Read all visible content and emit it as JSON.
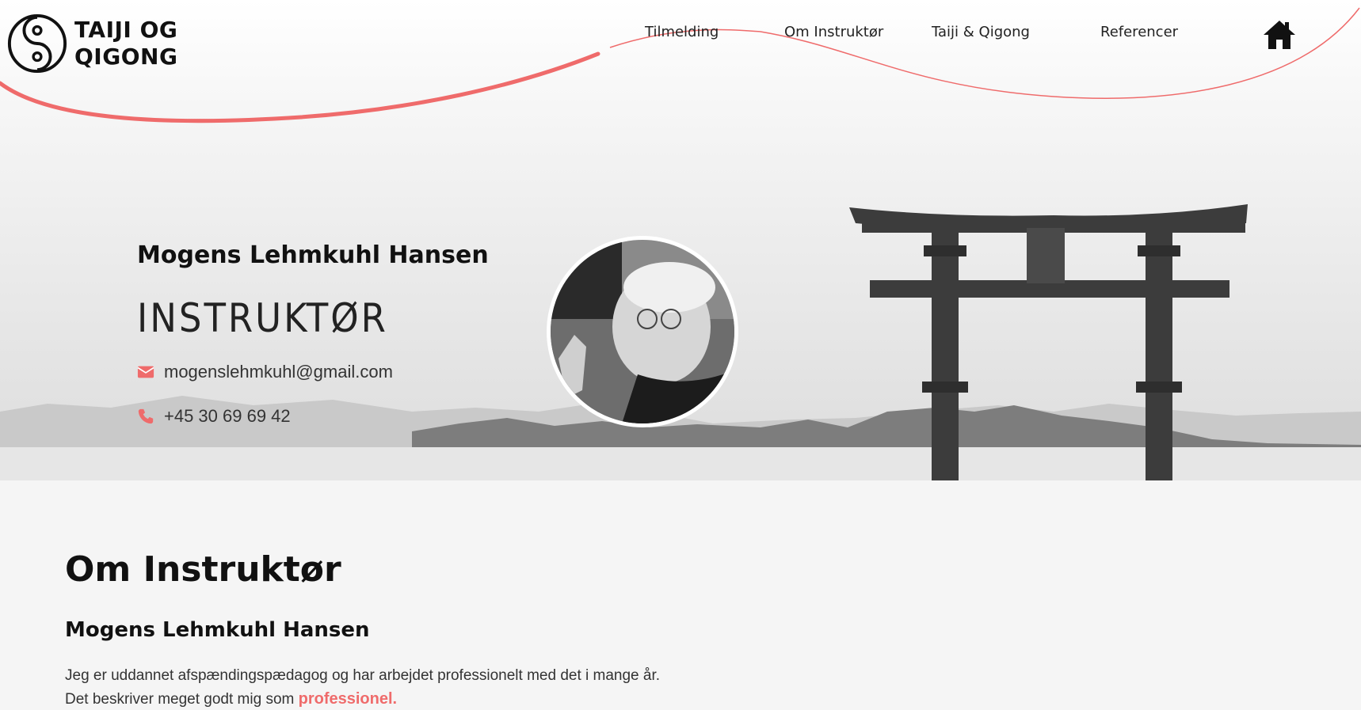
{
  "logo": {
    "line1": "TAIJI OG",
    "line2": "QIGONG"
  },
  "nav": {
    "items": [
      {
        "label": "Tilmelding"
      },
      {
        "label": "Om Instruktør"
      },
      {
        "label": "Taiji & Qigong"
      },
      {
        "label": "Referencer"
      }
    ],
    "home_icon": "home-icon"
  },
  "hero": {
    "name": "Mogens Lehmkuhl Hansen",
    "role": "INSTRUKTØR",
    "email": "mogenslehmkuhl@gmail.com",
    "phone": "+45 30 69 69 42",
    "email_icon": "envelope-icon",
    "phone_icon": "phone-icon"
  },
  "about": {
    "title": "Om Instruktør",
    "subtitle": "Mogens Lehmkuhl Hansen",
    "paragraph1": "Jeg er uddannet afspændingspædagog og har arbejdet professionelt med det i mange år.",
    "paragraph2_prefix": "Det beskriver meget godt mig som",
    "paragraph2_highlight": "professionel."
  },
  "colors": {
    "accent": "#ef6b6b",
    "text": "#111111",
    "section_bg": "#f5f5f5"
  }
}
